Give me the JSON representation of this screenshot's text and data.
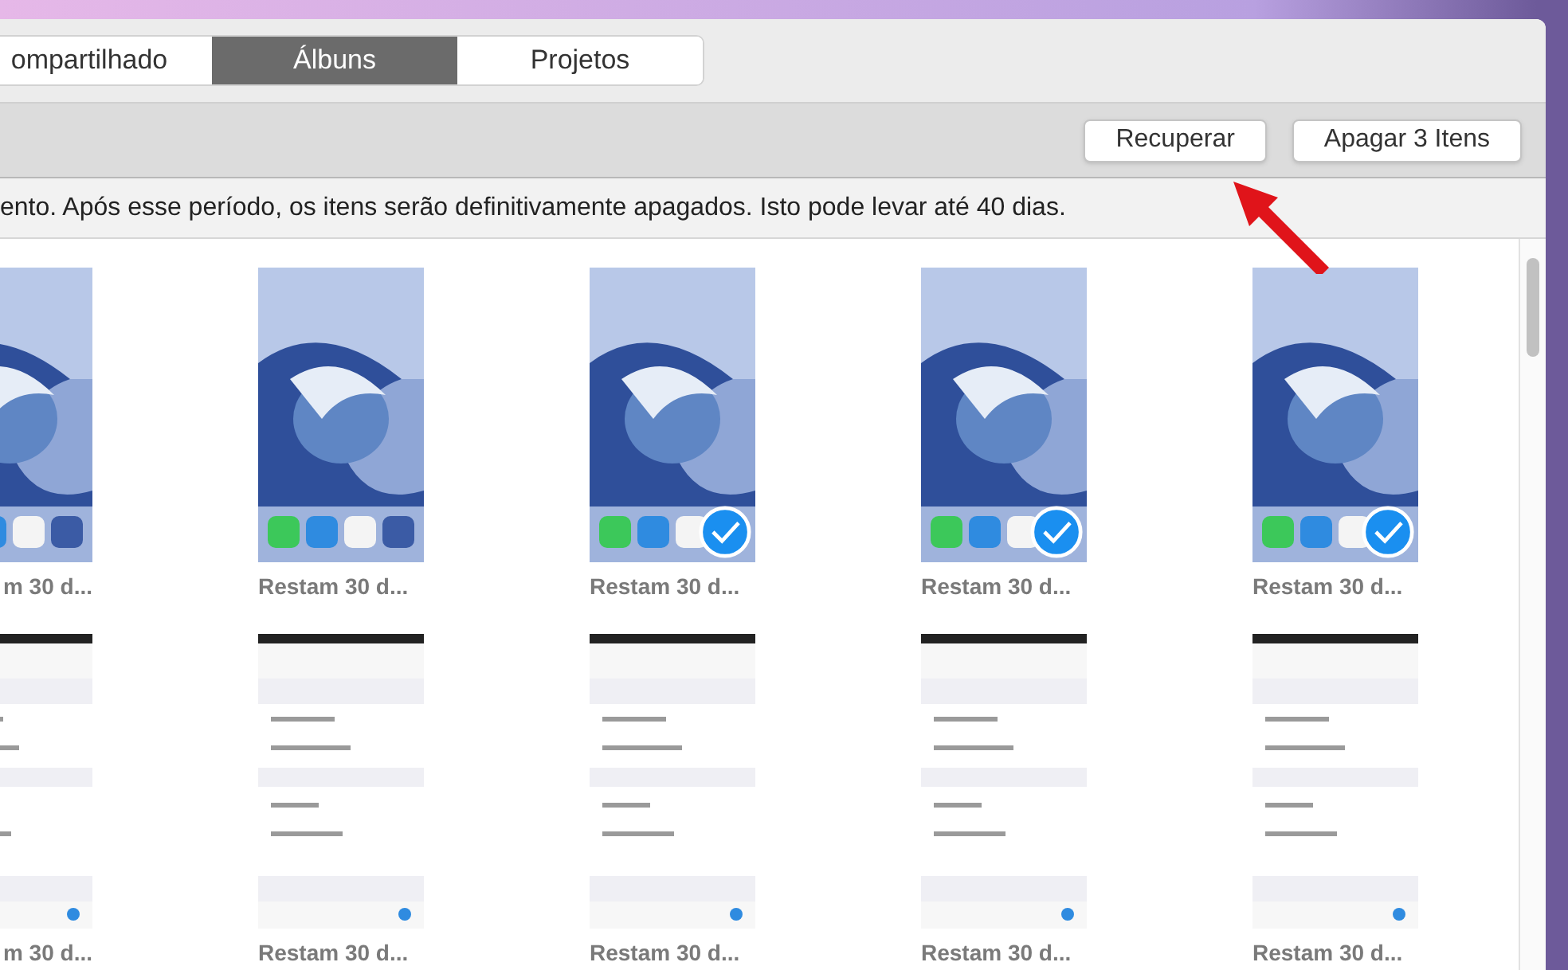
{
  "tabs": [
    {
      "label": "ompartilhado",
      "selected": false
    },
    {
      "label": "Álbuns",
      "selected": true
    },
    {
      "label": "Projetos",
      "selected": false
    }
  ],
  "buttons": [
    "Recuperar",
    "Apagar 3 Itens"
  ],
  "notice": "ento. Após esse período, os itens serão definitivamente apagados. Isto pode levar até 40 dias.",
  "photo_rows": [
    [
      {
        "caption": "m 30 d...",
        "selected": false
      },
      {
        "caption": "Restam 30 d...",
        "selected": false
      },
      {
        "caption": "Restam 30 d...",
        "selected": true
      },
      {
        "caption": "Restam 30 d...",
        "selected": true
      },
      {
        "caption": "Restam 30 d...",
        "selected": true
      }
    ],
    [
      {
        "caption": "m 30 d...",
        "selected": false
      },
      {
        "caption": "Restam 30 d...",
        "selected": false
      },
      {
        "caption": "Restam 30 d...",
        "selected": false
      },
      {
        "caption": "Restam 30 d...",
        "selected": false
      },
      {
        "caption": "Restam 30 d...",
        "selected": false
      }
    ]
  ]
}
